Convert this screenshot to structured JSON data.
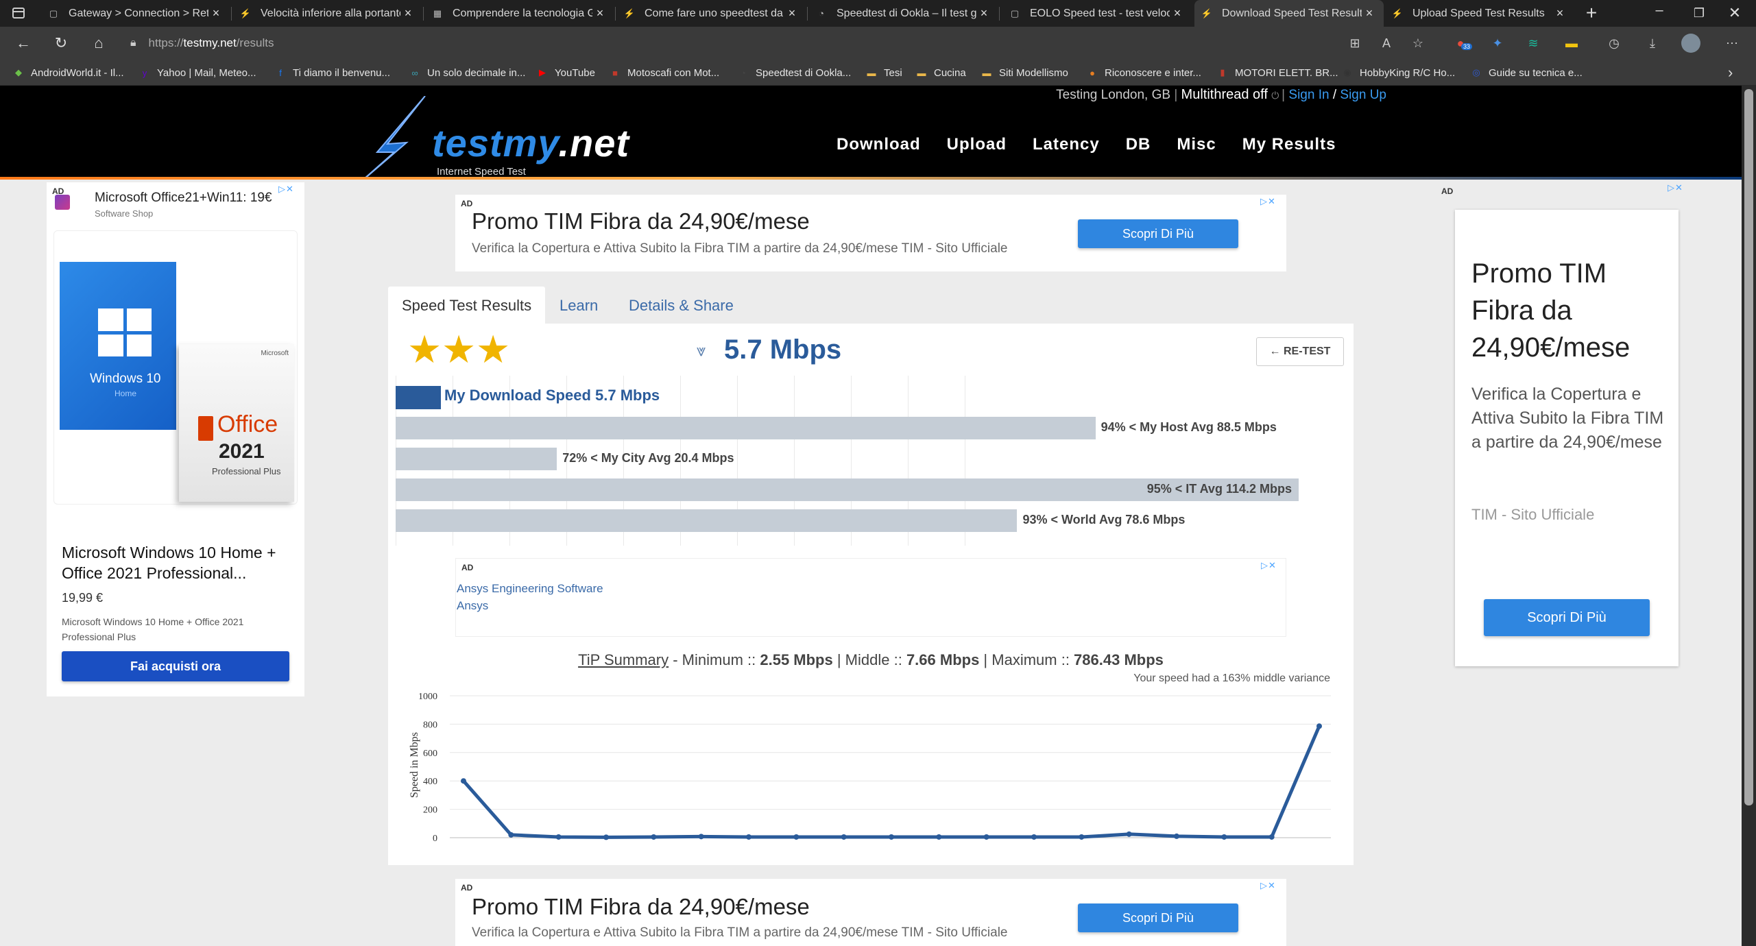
{
  "tabs": [
    {
      "title": "Gateway > Connection > Rete",
      "icon": "page"
    },
    {
      "title": "Velocità inferiore alla portante",
      "icon": "bolt"
    },
    {
      "title": "Comprendere la tecnologia G",
      "icon": "grid"
    },
    {
      "title": "Come fare uno speedtest da",
      "icon": "bolt"
    },
    {
      "title": "Speedtest di Ookla – Il test gl",
      "icon": "ookla"
    },
    {
      "title": "EOLO Speed test - test velocit",
      "icon": "page"
    },
    {
      "title": "Download Speed Test Results",
      "icon": "testmy",
      "active": true
    },
    {
      "title": "Upload Speed Test Results",
      "icon": "testmy"
    }
  ],
  "address": {
    "scheme": "https://",
    "host": "testmy.net",
    "path": "/results"
  },
  "notification_count": "33",
  "bookmarks": [
    {
      "label": "AndroidWorld.it - Il...",
      "color": "#6cc04a",
      "glyph": "◆"
    },
    {
      "label": "Yahoo | Mail, Meteo...",
      "color": "#6001d2",
      "glyph": "y"
    },
    {
      "label": "Ti diamo il benvenu...",
      "color": "#1877f2",
      "glyph": "f"
    },
    {
      "label": "Un solo decimale in...",
      "color": "#3aa0b0",
      "glyph": "∞"
    },
    {
      "label": "YouTube",
      "color": "#ff0000",
      "glyph": "▶"
    },
    {
      "label": "Motoscafi con Mot...",
      "color": "#c0392b",
      "glyph": "■"
    },
    {
      "label": "Speedtest di Ookla...",
      "color": "#444",
      "glyph": "◔"
    },
    {
      "label": "Tesi",
      "color": "#e8b64a",
      "glyph": "▬"
    },
    {
      "label": "Cucina",
      "color": "#e8b64a",
      "glyph": "▬"
    },
    {
      "label": "Siti Modellismo",
      "color": "#e8b64a",
      "glyph": "▬"
    },
    {
      "label": "Riconoscere e inter...",
      "color": "#e67e22",
      "glyph": "●"
    },
    {
      "label": "MOTORI ELETT. BR...",
      "color": "#c0392b",
      "glyph": "▮"
    },
    {
      "label": "HobbyKing R/C Ho...",
      "color": "#333",
      "glyph": "◉"
    },
    {
      "label": "Guide su tecnica e...",
      "color": "#2e5bd6",
      "glyph": "◎"
    }
  ],
  "site": {
    "testing_location": "Testing London, GB",
    "multithread": "Multithread off",
    "sign_in": "Sign In",
    "sign_up": "Sign Up",
    "logo_main": "testmy",
    "logo_tld": ".net",
    "logo_sub": "Internet Speed Test",
    "nav": [
      "Download",
      "Upload",
      "Latency",
      "DB",
      "Misc",
      "My Results"
    ]
  },
  "ads": {
    "ad_label": "AD",
    "top_banner": {
      "title": "Promo TIM Fibra da 24,90€/mese",
      "text": "Verifica la Copertura e Attiva Subito la Fibra TIM a partire da 24,90€/mese TIM - Sito Ufficiale",
      "button": "Scopri Di Più"
    },
    "bottom_banner": {
      "title": "Promo TIM Fibra da 24,90€/mese",
      "text": "Verifica la Copertura e Attiva Subito la Fibra TIM a partire da 24,90€/mese TIM - Sito Ufficiale",
      "button": "Scopri Di Più"
    },
    "left": {
      "header": "Microsoft Office21+Win11: 19€",
      "sub": "Software Shop",
      "product": "Microsoft Windows 10 Home + Office 2021 Professional...",
      "price": "19,99 €",
      "desc": "Microsoft Windows 10 Home + Office 2021 Professional Plus",
      "button": "Fai acquisti ora",
      "box_win": "Windows 10",
      "box_win_sub": "Home",
      "box_office": "Office",
      "box_year": "2021",
      "box_plus": "Professional Plus",
      "box_ms": "Microsoft"
    },
    "right": {
      "title": "Promo TIM Fibra da 24,90€/mese",
      "text": "Verifica la Copertura e Attiva Subito la Fibra TIM a partire da 24,90€/mese",
      "source": "TIM - Sito Ufficiale",
      "button": "Scopri Di Più"
    },
    "inline": {
      "line1": "Ansys Engineering Software",
      "line2": "Ansys"
    }
  },
  "results": {
    "tabs": [
      "Speed Test Results",
      "Learn",
      "Details & Share"
    ],
    "speed": "5.7 Mbps",
    "rating_stars": 3,
    "retest": "← RE-TEST",
    "legend": "My Download Speed 5.7 Mbps",
    "comparisons": [
      {
        "label": "94% < My Host Avg 88.5 Mbps",
        "value": 88.5
      },
      {
        "label": "72% < My City Avg 20.4 Mbps",
        "value": 20.4
      },
      {
        "label": "95% < IT Avg 114.2 Mbps",
        "value": 114.2
      },
      {
        "label": "93% < World Avg 78.6 Mbps",
        "value": 78.6
      }
    ],
    "my_speed_value": 5.7,
    "tip_summary": {
      "link": "TiP Summary",
      "min_label": " - Minimum :: ",
      "min": "2.55 Mbps",
      "mid_label": " | Middle :: ",
      "mid": "7.66 Mbps",
      "max_label": " | Maximum :: ",
      "max": "786.43 Mbps"
    },
    "variance": "Your speed had a 163% middle variance"
  },
  "chart_data": {
    "type": "line",
    "ylabel": "Speed in Mbps",
    "ylim": [
      0,
      1000
    ],
    "yticks": [
      0,
      200,
      400,
      600,
      800,
      1000
    ],
    "color": "#2a5b9a",
    "series": [
      {
        "values": [
          400,
          20,
          5,
          3,
          5,
          8,
          5,
          5,
          5,
          5,
          5,
          5,
          5,
          5,
          25,
          10,
          5,
          5,
          786
        ]
      }
    ]
  }
}
